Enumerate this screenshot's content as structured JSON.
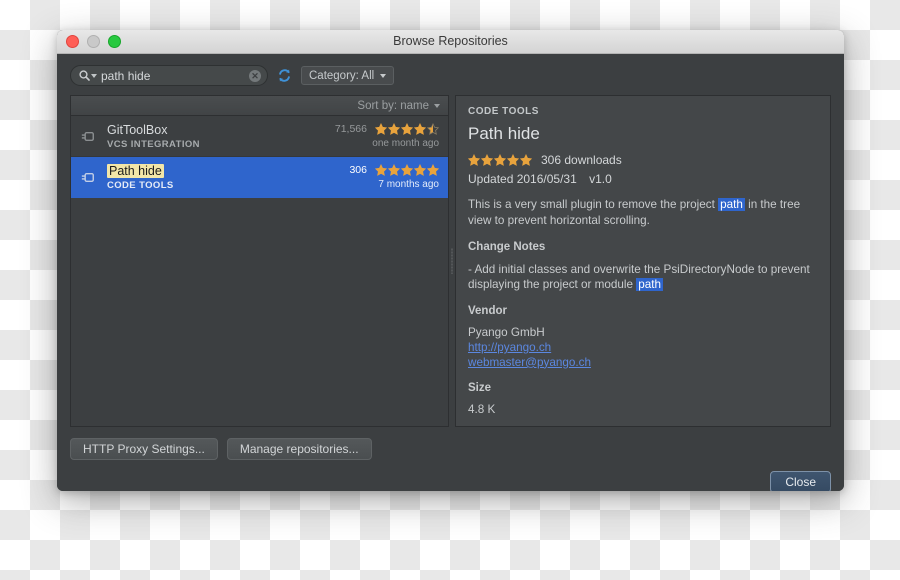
{
  "window": {
    "title": "Browse Repositories",
    "traffic_lights": [
      "close-button",
      "minimize-button",
      "zoom-button"
    ]
  },
  "toolbar": {
    "search": {
      "value": "path hide",
      "placeholder": "Search",
      "icon": "search-icon",
      "clear_icon": "clear-icon",
      "clear_glyph": "✕"
    },
    "refresh_icon": "refresh-icon",
    "category": {
      "label": "Category: All"
    }
  },
  "list": {
    "sort_label": "Sort by: name",
    "items": [
      {
        "name": "GitToolBox",
        "name_highlight": "",
        "category": "VCS INTEGRATION",
        "downloads": "71,566",
        "rating": 4.5,
        "date": "one month ago",
        "selected": false
      },
      {
        "name": "Path hide",
        "name_highlight": "Path hide",
        "category": "CODE TOOLS",
        "downloads": "306",
        "rating": 5,
        "date": "7 months ago",
        "selected": true
      }
    ]
  },
  "detail": {
    "category": "CODE TOOLS",
    "title": "Path hide",
    "rating": 5,
    "downloads": "306 downloads",
    "updated": "Updated 2016/05/31",
    "version": "v1.0",
    "description_before": "This is a very small plugin to remove the project ",
    "description_keyword": "path",
    "description_after": " in the tree view to prevent horizontal scrolling.",
    "change_notes_heading": "Change Notes",
    "change_notes_before": "- Add initial classes and overwrite the PsiDirectoryNode to prevent displaying the project or module ",
    "change_notes_keyword": "path",
    "vendor_heading": "Vendor",
    "vendor_name": "Pyango GmbH",
    "vendor_url": "http://pyango.ch",
    "vendor_email": "webmaster@pyango.ch",
    "size_heading": "Size",
    "size_value": "4.8 K"
  },
  "footer": {
    "http_proxy_label": "HTTP Proxy Settings...",
    "manage_repos_label": "Manage repositories...",
    "close_label": "Close"
  },
  "colors": {
    "selection_blue": "#2f65cc",
    "star_orange": "#e8a33d",
    "link_blue": "#5b87e0",
    "search_highlight": "#f2e6a8",
    "window_bg": "#3c3f41"
  }
}
